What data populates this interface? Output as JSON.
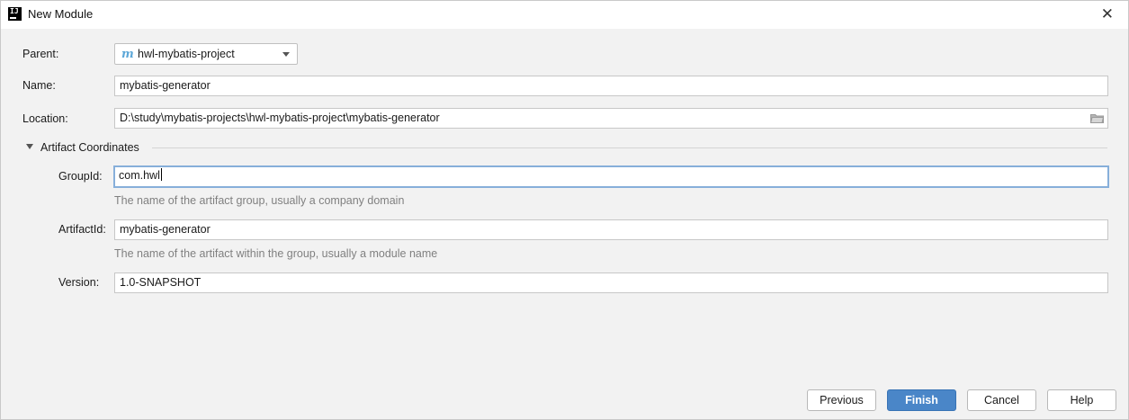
{
  "window": {
    "title": "New Module",
    "app_icon": "IJ"
  },
  "form": {
    "parent": {
      "label": "Parent:",
      "value": "hwl-mybatis-project",
      "icon": "maven-icon"
    },
    "name": {
      "label": "Name:",
      "value": "mybatis-generator"
    },
    "location": {
      "label": "Location:",
      "value": "D:\\study\\mybatis-projects\\hwl-mybatis-project\\mybatis-generator"
    }
  },
  "artifact": {
    "section_title": "Artifact Coordinates",
    "group_id": {
      "label": "GroupId:",
      "value": "com.hwl",
      "hint": "The name of the artifact group, usually a company domain"
    },
    "artifact_id": {
      "label": "ArtifactId:",
      "value": "mybatis-generator",
      "hint": "The name of the artifact within the group, usually a module name"
    },
    "version": {
      "label": "Version:",
      "value": "1.0-SNAPSHOT"
    }
  },
  "buttons": {
    "previous": "Previous",
    "finish": "Finish",
    "cancel": "Cancel",
    "help": "Help"
  },
  "colors": {
    "accent": "#4a86c8",
    "focus": "#87afda",
    "maven": "#5ea8d8"
  }
}
